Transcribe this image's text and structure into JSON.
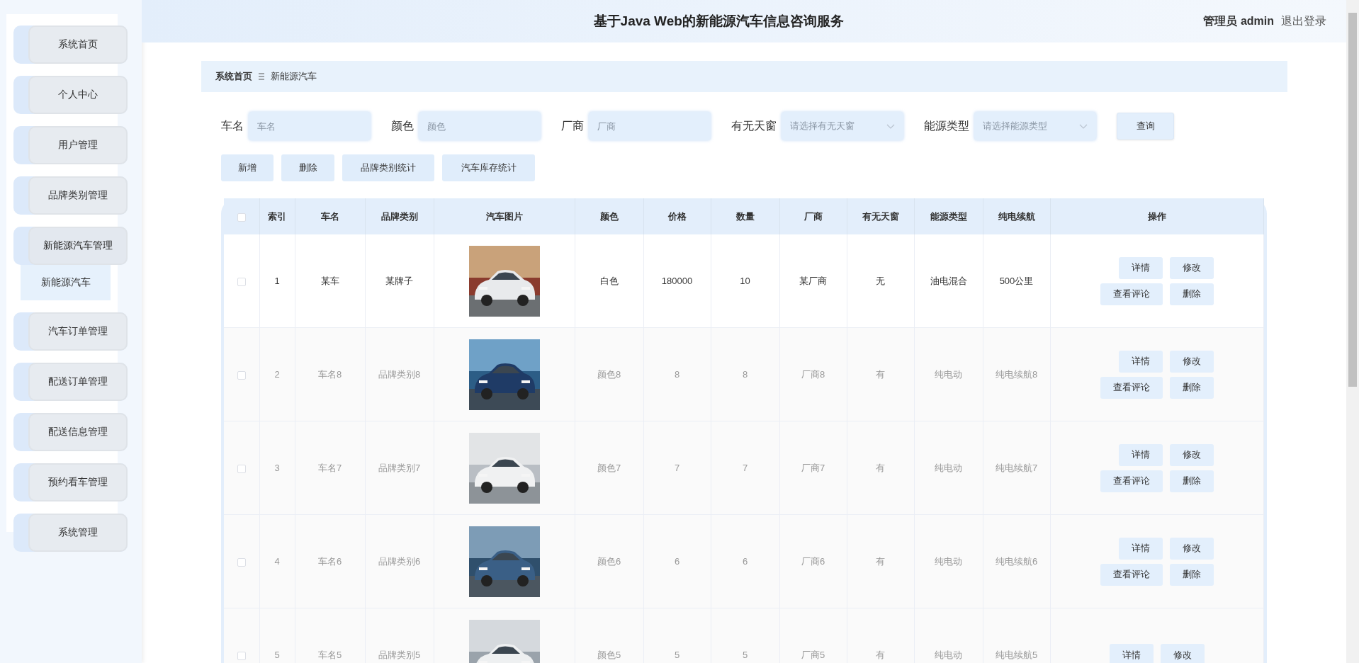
{
  "header": {
    "title": "基于Java Web的新能源汽车信息咨询服务",
    "user_role": "管理员",
    "username": "admin",
    "logout": "退出登录"
  },
  "sidebar": {
    "items": [
      {
        "label": "系统首页",
        "expanded": false
      },
      {
        "label": "个人中心",
        "expanded": false
      },
      {
        "label": "用户管理",
        "expanded": false
      },
      {
        "label": "品牌类别管理",
        "expanded": false
      },
      {
        "label": "新能源汽车管理",
        "expanded": true,
        "children": [
          {
            "label": "新能源汽车",
            "selected": true
          }
        ]
      },
      {
        "label": "汽车订单管理",
        "expanded": false
      },
      {
        "label": "配送订单管理",
        "expanded": false
      },
      {
        "label": "配送信息管理",
        "expanded": false
      },
      {
        "label": "预约看车管理",
        "expanded": false
      },
      {
        "label": "系统管理",
        "expanded": false
      }
    ]
  },
  "breadcrumb": [
    {
      "label": "系统首页"
    },
    {
      "label": "新能源汽车"
    }
  ],
  "filters": [
    {
      "kind": "text",
      "label": "车名",
      "placeholder": "车名"
    },
    {
      "kind": "text",
      "label": "颜色",
      "placeholder": "颜色"
    },
    {
      "kind": "text",
      "label": "厂商",
      "placeholder": "厂商"
    },
    {
      "kind": "select",
      "label": "有无天窗",
      "placeholder": "请选择有无天窗"
    },
    {
      "kind": "select",
      "label": "能源类型",
      "placeholder": "请选择能源类型"
    }
  ],
  "search_button": "查询",
  "actions": [
    "新增",
    "删除",
    "品牌类别统计",
    "汽车库存统计"
  ],
  "table": {
    "all_checked": false,
    "columns": [
      "索引",
      "车名",
      "品牌类别",
      "汽车图片",
      "颜色",
      "价格",
      "数量",
      "厂商",
      "有无天窗",
      "能源类型",
      "纯电续航",
      "操作"
    ],
    "rows": [
      {
        "checked": false,
        "highlighted": true,
        "cells": [
          "1",
          "某车",
          "某牌子",
          {
            "kind": "picture"
          },
          "白色",
          "180000",
          "10",
          "某厂商",
          "无",
          "油电混合",
          "500公里"
        ],
        "actions": [
          "详情",
          "修改",
          "查看评论",
          "删除"
        ]
      },
      {
        "checked": false,
        "highlighted": false,
        "cells": [
          "2",
          "车名8",
          "品牌类别8",
          {
            "kind": "picture"
          },
          "颜色8",
          "8",
          "8",
          "厂商8",
          "有",
          "纯电动",
          "纯电续航8"
        ],
        "actions": [
          "详情",
          "修改",
          "查看评论",
          "删除"
        ]
      },
      {
        "checked": false,
        "highlighted": false,
        "cells": [
          "3",
          "车名7",
          "品牌类别7",
          {
            "kind": "picture"
          },
          "颜色7",
          "7",
          "7",
          "厂商7",
          "有",
          "纯电动",
          "纯电续航7"
        ],
        "actions": [
          "详情",
          "修改",
          "查看评论",
          "删除"
        ]
      },
      {
        "checked": false,
        "highlighted": false,
        "cells": [
          "4",
          "车名6",
          "品牌类别6",
          {
            "kind": "picture"
          },
          "颜色6",
          "6",
          "6",
          "厂商6",
          "有",
          "纯电动",
          "纯电续航6"
        ],
        "actions": [
          "详情",
          "修改",
          "查看评论",
          "删除"
        ]
      },
      {
        "checked": false,
        "highlighted": false,
        "cells": [
          "5",
          "车名5",
          "品牌类别5",
          {
            "kind": "picture"
          },
          "颜色5",
          "5",
          "5",
          "厂商5",
          "有",
          "纯电动",
          "纯电续航5"
        ],
        "actions": [
          "详情",
          "修改"
        ]
      }
    ]
  }
}
